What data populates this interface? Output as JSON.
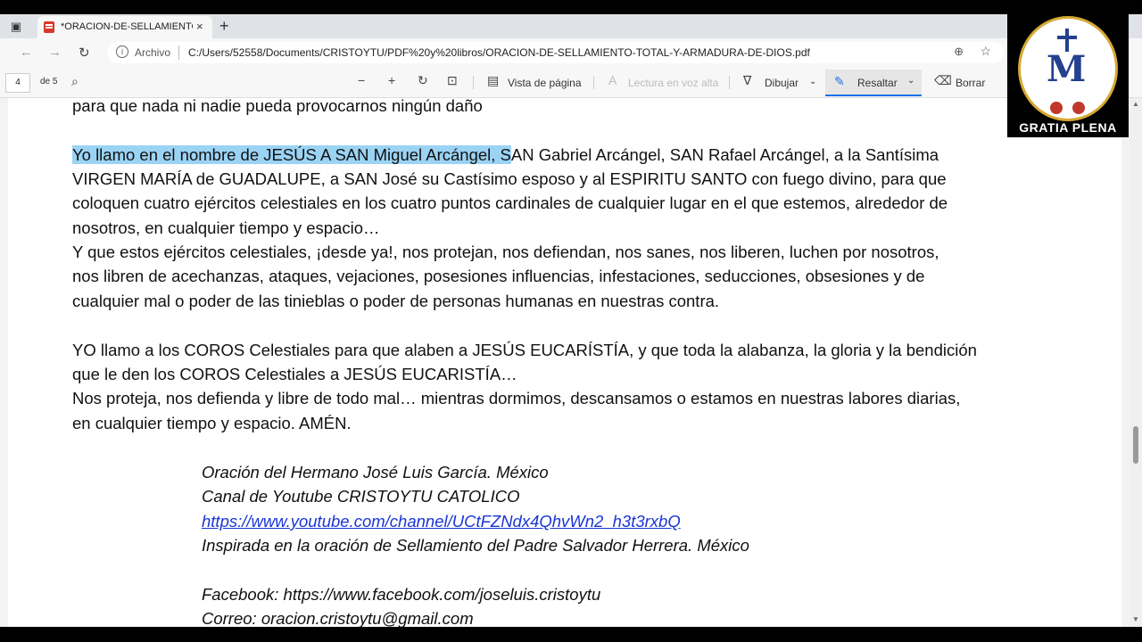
{
  "browser": {
    "tab_title": "*ORACION-DE-SELLAMIENTO-T",
    "tab_close": "×",
    "new_tab": "+",
    "address_prefix": "Archivo",
    "url": "C:/Users/52558/Documents/CRISTOYTU/PDF%20y%20libros/ORACION-DE-SELLAMIENTO-TOTAL-Y-ARMADURA-DE-DIOS.pdf"
  },
  "pdf_toolbar": {
    "page_current": "4",
    "page_total": "de 5",
    "page_view": "Vista de página",
    "read_aloud": "Lectura en voz alta",
    "draw": "Dibujar",
    "highlight": "Resaltar",
    "erase": "Borrar"
  },
  "document": {
    "line0": "para que nada ni nadie pueda provocarnos ningún daño",
    "p1_highlighted": "Yo llamo en el nombre de JESÚS A SAN Miguel Arcángel, S",
    "p1_rest": "AN Gabriel Arcángel, SAN Rafael Arcángel, a la Santísima",
    "p1_l2": "VIRGEN MARÍA de GUADALUPE, a SAN José su Castísimo esposo y al ESPIRITU SANTO con fuego divino, para que",
    "p1_l3": "coloquen cuatro ejércitos celestiales en los cuatro puntos cardinales de cualquier lugar en el que estemos, alrededor de",
    "p1_l4": "nosotros, en cualquier tiempo y espacio…",
    "p1_l5": "Y que estos ejércitos celestiales, ¡desde ya!, nos protejan, nos defiendan, nos sanes, nos liberen, luchen por nosotros,",
    "p1_l6": "nos libren de acechanzas, ataques, vejaciones, posesiones influencias, infestaciones, seducciones, obsesiones y de",
    "p1_l7": "cualquier mal o poder de las tinieblas o poder de personas humanas en nuestras contra.",
    "p2_l1": "YO llamo a los COROS Celestiales para que alaben a JESÚS EUCARÍSTÍA, y que toda la alabanza, la gloria y la bendición",
    "p2_l2": "que le den los COROS Celestiales a JESÚS EUCARISTÍA…",
    "p2_l3": "Nos proteja, nos defienda y libre de todo mal… mientras dormimos, descansamos o estamos en nuestras labores diarias,",
    "p2_l4": "en cualquier tiempo y espacio. AMÉN.",
    "credit1": "Oración del Hermano José Luis García. México",
    "credit2": "Canal de Youtube CRISTOYTU CATOLICO",
    "credit3": "https://www.youtube.com/channel/UCtFZNdx4QhvWn2_h3t3rxbQ",
    "credit4": "Inspirada en la oración de Sellamiento del Padre Salvador Herrera. México",
    "credit5": "Facebook: https://www.facebook.com/joseluis.cristoytu",
    "credit6": "Correo: oracion.cristoytu@gmail.com"
  },
  "logo": {
    "text": "GRATIA PLENA"
  },
  "colors": {
    "highlight": "#9bd3f4",
    "link": "#1a35d6",
    "accent": "#1a73e8"
  }
}
